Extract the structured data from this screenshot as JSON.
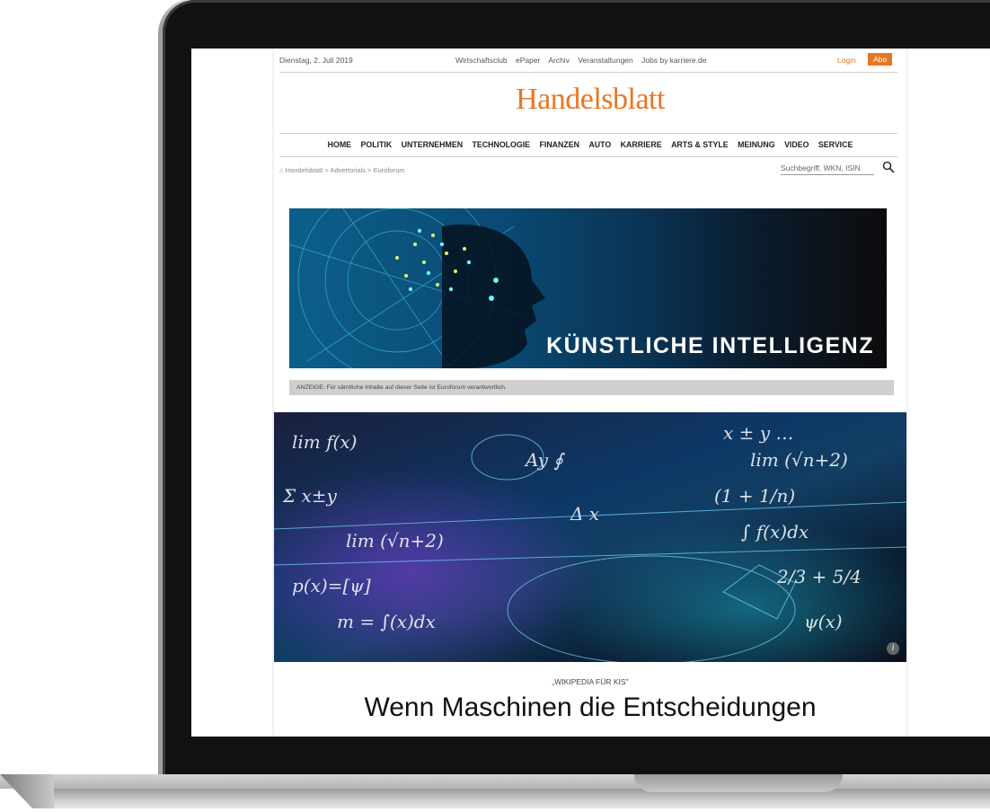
{
  "topbar": {
    "date": "Dienstag, 2. Juli 2019",
    "links": [
      "Wirtschaftsclub",
      "ePaper",
      "Archiv",
      "Veranstaltungen",
      "Jobs by karriere.de"
    ],
    "login": "Login",
    "abo": "Abo"
  },
  "logo": "Handelsblatt",
  "nav": [
    "HOME",
    "POLITIK",
    "UNTERNEHMEN",
    "TECHNOLOGIE",
    "FINANZEN",
    "AUTO",
    "KARRIERE",
    "ARTS & STYLE",
    "MEINUNG",
    "VIDEO",
    "SERVICE"
  ],
  "breadcrumb": "Handelsblatt  >  Advertorials  >  Euroforum",
  "search": {
    "placeholder": "Suchbegriff, WKN, ISIN"
  },
  "banner": {
    "title": "KÜNSTLICHE INTELLIGENZ"
  },
  "anzeige": "ANZEIGE: Für sämtliche Inhalte auf dieser Seite ist Euroforum verantwortlich.",
  "hero": {
    "info": "i"
  },
  "article": {
    "kicker": "„WIKIPEDIA FÜR KIS\"",
    "headline": "Wenn Maschinen die Entscheidungen"
  },
  "colors": {
    "accent": "#e87722"
  }
}
